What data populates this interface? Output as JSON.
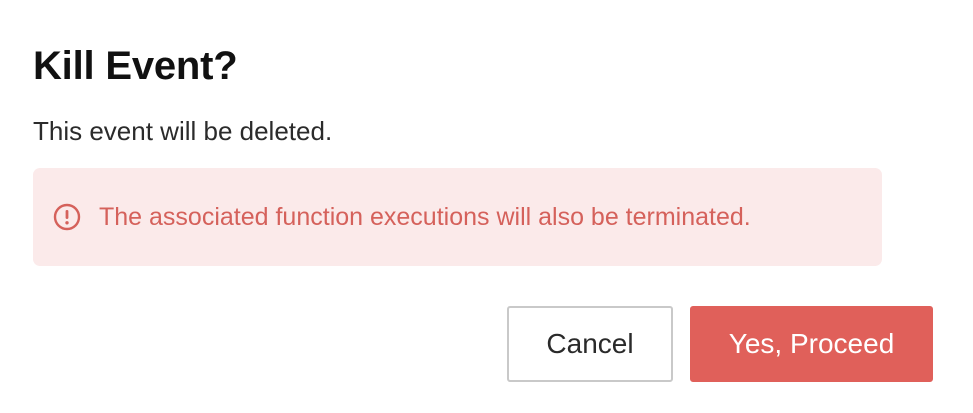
{
  "dialog": {
    "title": "Kill Event?",
    "message": "This event will be deleted.",
    "alert": {
      "icon": "exclamation-circle-icon",
      "text": "The associated function executions will also be terminated.",
      "text_color": "#d5615b",
      "background_color": "#fbeaea"
    },
    "buttons": {
      "cancel_label": "Cancel",
      "proceed_label": "Yes, Proceed",
      "proceed_color": "#e0605a"
    }
  }
}
